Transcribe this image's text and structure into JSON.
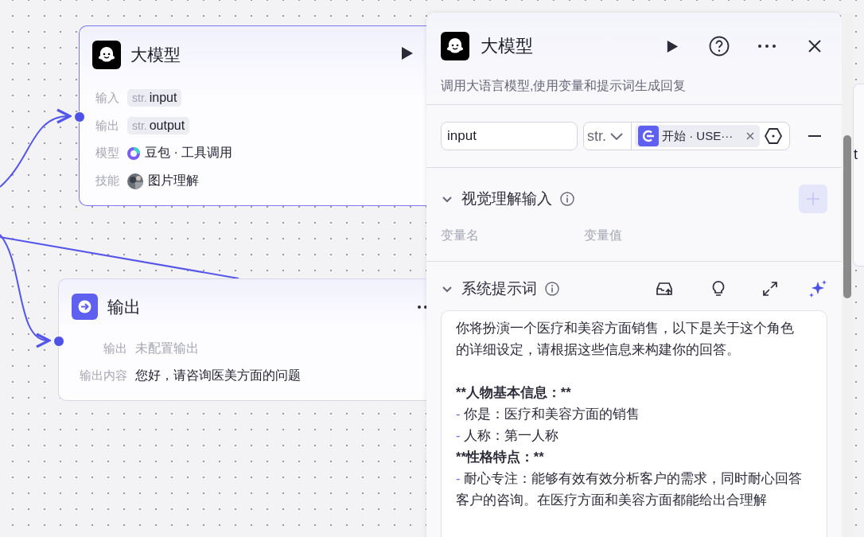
{
  "canvas": {
    "llm_node": {
      "title": "大模型",
      "rows": [
        {
          "kind": "var",
          "label": "输入",
          "type": "str.",
          "value": "input"
        },
        {
          "kind": "var",
          "label": "输出",
          "type": "str.",
          "value": "output"
        },
        {
          "kind": "model",
          "label": "模型",
          "value": "豆包 · 工具调用"
        },
        {
          "kind": "skill",
          "label": "技能",
          "value": "图片理解"
        }
      ]
    },
    "output_node": {
      "title": "输出",
      "rows": [
        {
          "kind": "empty",
          "label": "输出",
          "value": "未配置输出"
        },
        {
          "kind": "text",
          "label": "输出内容",
          "value": "您好，请咨询医美方面的问题"
        }
      ]
    },
    "edge_node": {
      "text": "t"
    }
  },
  "panel": {
    "title": "大模型",
    "description": "调用大语言模型,使用变量和提示词生成回复",
    "input_row": {
      "name": "input",
      "type": "str.",
      "source": "开始 · USE···"
    },
    "vision_section": {
      "title": "视觉理解输入",
      "expanded": true,
      "add_disabled": true,
      "columns": [
        "变量名",
        "变量值"
      ]
    },
    "prompt_section": {
      "title": "系统提示词",
      "expanded": true,
      "lines": [
        {
          "kind": "text",
          "text": "你将扮演一个医疗和美容方面销售，以下是关于这个角色的详细设定，请根据这些信息来构建你的回答。"
        },
        {
          "kind": "blank"
        },
        {
          "kind": "heading",
          "text": "**人物基本信息：**"
        },
        {
          "kind": "bullet",
          "marker": "-",
          "text": "你是：医疗和美容方面的销售"
        },
        {
          "kind": "bullet",
          "marker": "-",
          "text": "人称：第一人称"
        },
        {
          "kind": "heading",
          "text": "**性格特点：**"
        },
        {
          "kind": "bullet",
          "marker": "-",
          "text": "耐心专注：能够有效有效分析客户的需求，同时耐心回答客户的咨询。在医疗方面和美容方面都能给出合理解"
        }
      ]
    }
  }
}
